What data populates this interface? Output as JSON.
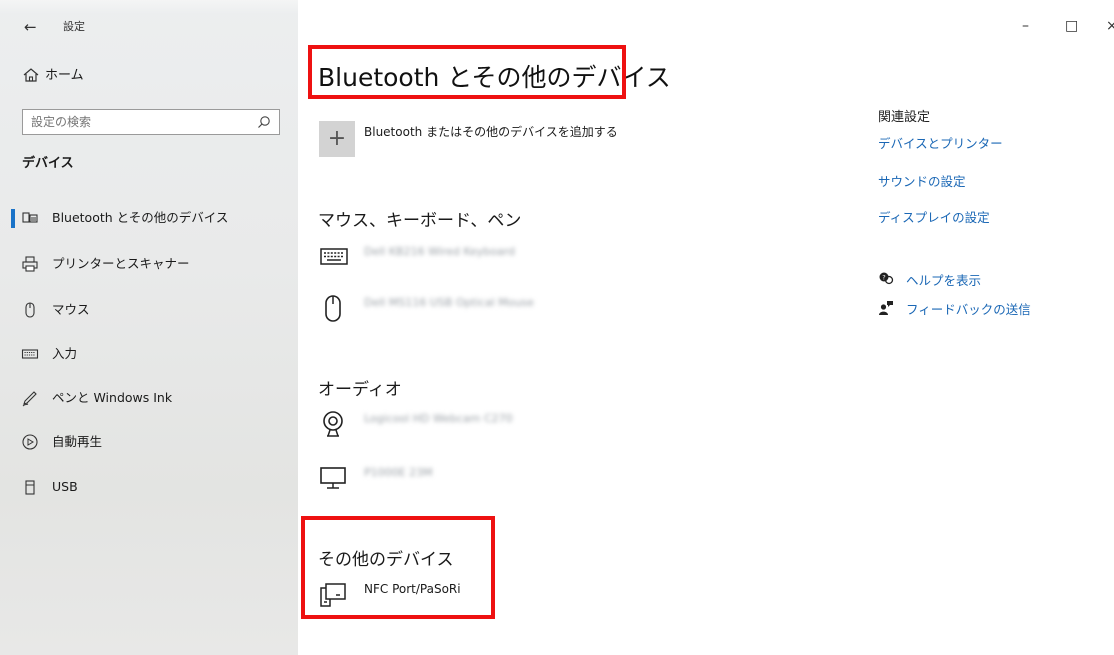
{
  "app": {
    "title": "設定",
    "back_icon": "arrow-left-icon"
  },
  "window_controls": {
    "minimize": "–",
    "maximize": "□",
    "close": "×"
  },
  "sidebar": {
    "home_label": "ホーム",
    "search_placeholder": "設定の検索",
    "section_title": "デバイス",
    "items": [
      {
        "label": "Bluetooth とその他のデバイス",
        "icon": "bluetooth-devices-icon",
        "active": true
      },
      {
        "label": "プリンターとスキャナー",
        "icon": "printer-icon"
      },
      {
        "label": "マウス",
        "icon": "mouse-icon"
      },
      {
        "label": "入力",
        "icon": "keyboard-icon"
      },
      {
        "label": "ペンと Windows Ink",
        "icon": "pen-icon"
      },
      {
        "label": "自動再生",
        "icon": "autoplay-icon"
      },
      {
        "label": "USB",
        "icon": "usb-icon"
      }
    ]
  },
  "main": {
    "title": "Bluetooth とその他のデバイス",
    "add_device_label": "Bluetooth またはその他のデバイスを追加する",
    "groups": {
      "input": {
        "heading": "マウス、キーボード、ペン",
        "devices": [
          "Dell KB216 Wired Keyboard",
          "Dell MS116 USB Optical Mouse"
        ]
      },
      "audio": {
        "heading": "オーディオ",
        "devices": [
          "Logicool HD Webcam C270",
          "P1000E 23M"
        ]
      },
      "other": {
        "heading": "その他のデバイス",
        "devices": [
          "NFC Port/PaSoRi"
        ]
      }
    }
  },
  "related": {
    "heading": "関連設定",
    "links": [
      "デバイスとプリンター",
      "サウンドの設定",
      "ディスプレイの設定"
    ],
    "help_label": "ヘルプを表示",
    "feedback_label": "フィードバックの送信"
  },
  "colors": {
    "accent": "#1a67b5",
    "highlight": "#ee1111"
  }
}
